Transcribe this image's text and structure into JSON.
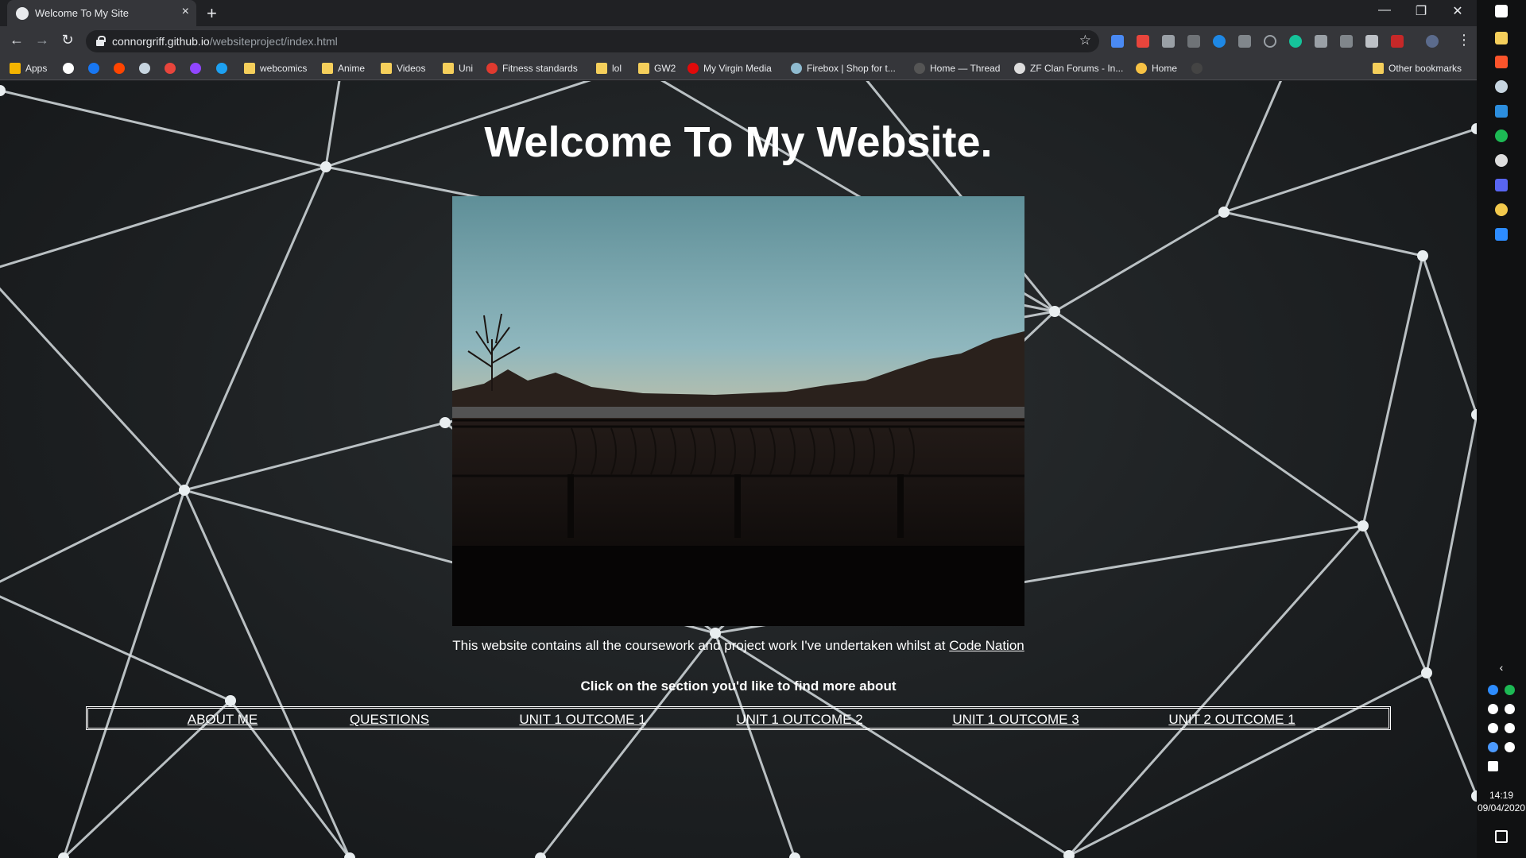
{
  "browser": {
    "tab_title": "Welcome To My Site",
    "new_tab_label": "+",
    "url_host": "connorgriff.github.io",
    "url_path": "/websiteproject/index.html",
    "window_controls": {
      "minimize": "—",
      "restore": "❐",
      "close": "✕"
    },
    "bookmarks": [
      {
        "label": "Apps",
        "icon": "apps-grid-icon",
        "color": "#f4b400"
      },
      {
        "label": "",
        "icon": "google-icon",
        "color": "#ffffff"
      },
      {
        "label": "",
        "icon": "facebook-icon",
        "color": "#1877f2"
      },
      {
        "label": "",
        "icon": "reddit-icon",
        "color": "#ff4500"
      },
      {
        "label": "",
        "icon": "steam-icon",
        "color": "#c7d5e0"
      },
      {
        "label": "",
        "icon": "crunchyroll-icon",
        "color": "#e8453c"
      },
      {
        "label": "",
        "icon": "twitch-icon",
        "color": "#9146ff"
      },
      {
        "label": "",
        "icon": "twitter-icon",
        "color": "#1da1f2"
      },
      {
        "label": "webcomics",
        "icon": "folder-icon",
        "color": "#f5cf5b"
      },
      {
        "label": "Anime",
        "icon": "folder-icon",
        "color": "#f5cf5b"
      },
      {
        "label": "Videos",
        "icon": "folder-icon",
        "color": "#f5cf5b"
      },
      {
        "label": "Uni",
        "icon": "folder-icon",
        "color": "#f5cf5b"
      },
      {
        "label": "Fitness standards",
        "icon": "fitness-icon",
        "color": "#e03a2f"
      },
      {
        "label": "lol",
        "icon": "folder-icon",
        "color": "#f5cf5b"
      },
      {
        "label": "GW2",
        "icon": "folder-icon",
        "color": "#f5cf5b"
      },
      {
        "label": "My Virgin Media",
        "icon": "virgin-media-icon",
        "color": "#e10a0a"
      },
      {
        "label": "Firebox | Shop for t...",
        "icon": "firebox-icon",
        "color": "#8fbbd0"
      },
      {
        "label": "Home — Thread",
        "icon": "thread-icon",
        "color": "#555555"
      },
      {
        "label": "ZF Clan Forums - In...",
        "icon": "zf-clan-icon",
        "color": "#dddddd"
      },
      {
        "label": "Home",
        "icon": "home-emoji-icon",
        "color": "#f7c244"
      },
      {
        "label": "",
        "icon": "circle-logo-icon",
        "color": "#444444"
      }
    ],
    "other_bookmarks": "Other bookmarks"
  },
  "page": {
    "heading": "Welcome To My Website.",
    "intro_text": "This website contains all the coursework and project work I've undertaken whilst at ",
    "intro_link": "Code Nation",
    "prompt": "Click on the section you'd like to find more about",
    "nav": [
      "ABOUT ME",
      "QUESTIONS",
      "UNIT 1 OUTCOME 1",
      "UNIT 1 OUTCOME 2",
      "UNIT 1 OUTCOME 3",
      "UNIT 2 OUTCOME 1"
    ]
  },
  "taskbar": {
    "time": "14:19",
    "date": "09/04/2020"
  },
  "colors": {
    "chrome_dark": "#202124",
    "chrome_toolbar": "#35363a",
    "page_text": "#ffffff",
    "mesh_line": "#d6dde0"
  }
}
